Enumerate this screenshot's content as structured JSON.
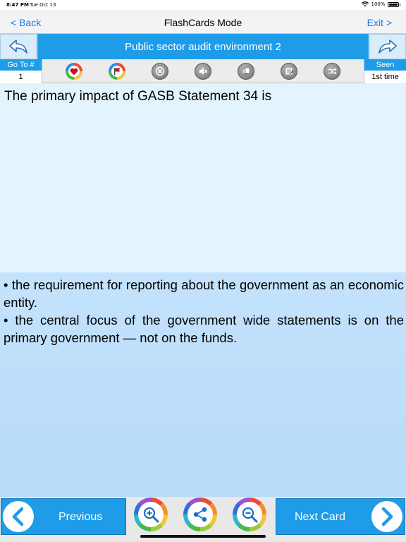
{
  "status": {
    "time": "8:47 PM",
    "date": "Tue Oct 13",
    "battery": "100%"
  },
  "nav": {
    "back_label": "< Back",
    "title": "FlashCards Mode",
    "exit_label": "Exit >"
  },
  "deck": {
    "title": "Public sector audit environment 2"
  },
  "goto": {
    "label": "Go To #",
    "value": "1"
  },
  "seen": {
    "label": "Seen",
    "value": "1st time"
  },
  "toolbar": {
    "icons": [
      "heart-favorite-icon",
      "flag-icon",
      "close-x-icon",
      "mute-speaker-icon",
      "cards-icon",
      "edit-note-icon",
      "shuffle-icon"
    ]
  },
  "card": {
    "question": "The primary impact of GASB Statement 34 is",
    "answer_lines": [
      "• the requirement for reporting about the government as an economic entity.",
      "• the central focus of the government wide statements is on the primary government — not on the funds."
    ]
  },
  "bottom": {
    "previous_label": "Previous",
    "next_label": "Next Card"
  },
  "colors": {
    "accent": "#1e9ce8",
    "question_bg": "#e4f4fe",
    "answer_bg": "#c4e2fb",
    "link": "#1a7be6"
  }
}
